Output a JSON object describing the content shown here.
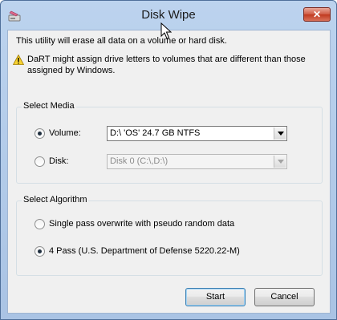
{
  "window": {
    "title": "Disk Wipe",
    "close_label": "✕",
    "app_icon": "disk-wipe-icon"
  },
  "info_text": "This utility will erase all data on a volume or hard disk.",
  "warning": {
    "icon": "warning-icon",
    "text": "DaRT might assign drive letters to volumes that are different than those assigned by Windows."
  },
  "media": {
    "title": "Select Media",
    "volume": {
      "label": "Volume:",
      "selected": true,
      "value": "D:\\ 'OS' 24.7 GB NTFS"
    },
    "disk": {
      "label": "Disk:",
      "selected": false,
      "value": "Disk 0 (C:\\,D:\\)",
      "enabled": false
    }
  },
  "algorithm": {
    "title": "Select Algorithm",
    "options": [
      {
        "label": "Single pass overwrite with pseudo random data",
        "selected": false
      },
      {
        "label": "4 Pass (U.S. Department of Defense 5220.22-M)",
        "selected": true
      }
    ]
  },
  "buttons": {
    "start": "Start",
    "cancel": "Cancel"
  },
  "colors": {
    "titlebar": "#bcd3ee",
    "close": "#c0391f",
    "dialog_bg": "#f0f0f0",
    "default_button_border": "#3c7fb1"
  }
}
